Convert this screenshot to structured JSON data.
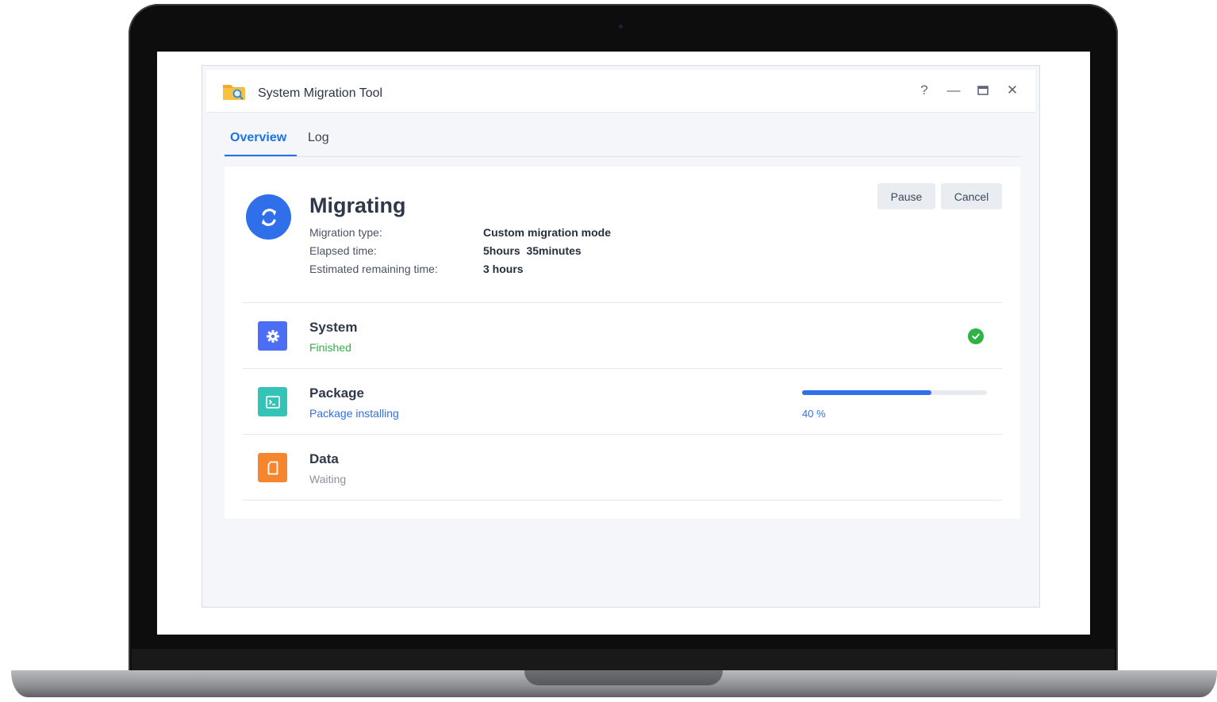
{
  "window": {
    "title": "System Migration Tool"
  },
  "window_controls": {
    "help": "?",
    "minimize": "—",
    "maximize": "▭",
    "close": "✕"
  },
  "tabs": [
    {
      "label": "Overview",
      "active": true
    },
    {
      "label": "Log",
      "active": false
    }
  ],
  "status": {
    "title": "Migrating",
    "icon": "sync-icon",
    "fields": [
      {
        "label": "Migration type:",
        "value": "Custom migration mode"
      },
      {
        "label": "Elapsed time:",
        "value": "5hours  35minutes"
      },
      {
        "label": "Estimated remaining time:",
        "value": "3 hours"
      }
    ]
  },
  "actions": {
    "pause": "Pause",
    "cancel": "Cancel"
  },
  "steps": [
    {
      "title": "System",
      "status": "Finished",
      "icon": "gear-icon",
      "color": "#4c6ef5",
      "status_color": "#2fb344",
      "done": true
    },
    {
      "title": "Package",
      "status": "Package installing",
      "icon": "terminal-icon",
      "color": "#33c3b7",
      "status_color": "#2f6fe9",
      "progress": 0.7,
      "progress_label": "40 %"
    },
    {
      "title": "Data",
      "status": "Waiting",
      "icon": "file-icon",
      "color": "#f5862e",
      "status_color": "#8a929e"
    }
  ],
  "colors": {
    "accent": "#2f6fe9",
    "success": "#2fb344"
  }
}
